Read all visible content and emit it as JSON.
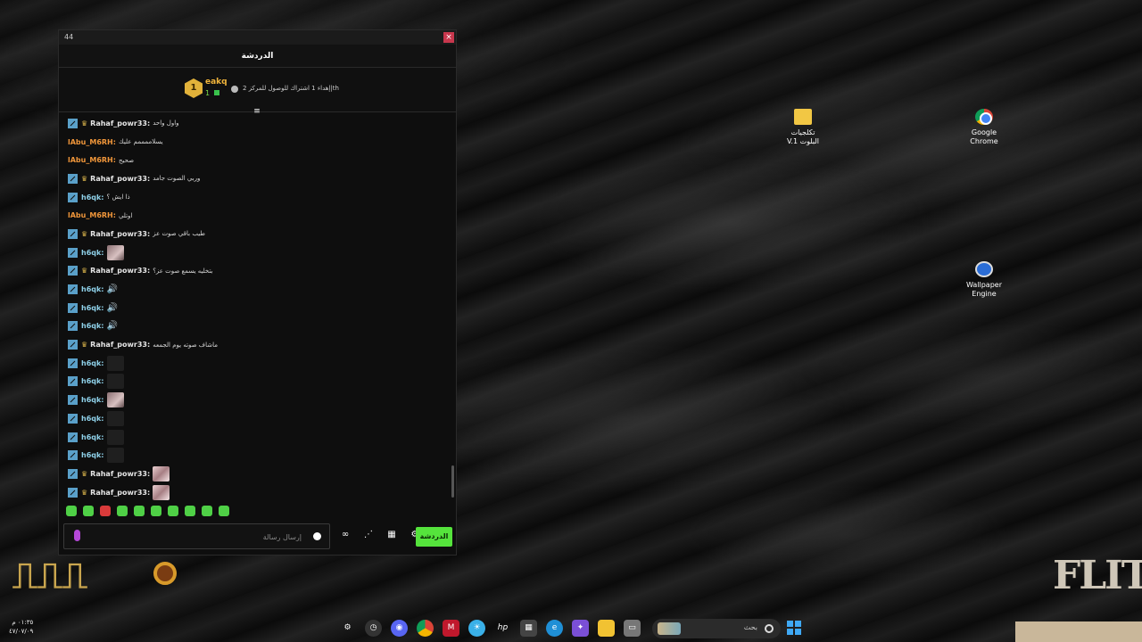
{
  "window": {
    "title": "44",
    "close_label": "×"
  },
  "chat": {
    "header_title": "الدردشة",
    "top_user": {
      "rank": "1",
      "username": "eakq",
      "count": "1",
      "info": "إهداء 1 اشتراك للوصول للمركز 2|th"
    },
    "collapse_icon": "≡",
    "messages": [
      {
        "user": "Rahaf_powr33:",
        "kind": "rahaf",
        "text": "واول واحد",
        "content": "text"
      },
      {
        "user": "lAbu_M6RH:",
        "kind": "abu",
        "text": "يسلاممممم عليك",
        "content": "text"
      },
      {
        "user": "lAbu_M6RH:",
        "kind": "abu",
        "text": "صحيح",
        "content": "text"
      },
      {
        "user": "Rahaf_powr33:",
        "kind": "rahaf",
        "text": "وربي الصوت جامد",
        "content": "text"
      },
      {
        "user": "h6qk:",
        "kind": "h6qk",
        "text": "ذا ايش ؟",
        "content": "text"
      },
      {
        "user": "lAbu_M6RH:",
        "kind": "abu",
        "text": "اوتلي",
        "content": "text"
      },
      {
        "user": "Rahaf_powr33:",
        "kind": "rahaf",
        "text": "طيب باقي صوت عز",
        "content": "text"
      },
      {
        "user": "h6qk:",
        "kind": "h6qk",
        "text": "",
        "content": "photo"
      },
      {
        "user": "Rahaf_powr33:",
        "kind": "rahaf",
        "text": "بتخليه يسمع صوت عز؟",
        "content": "text"
      },
      {
        "user": "h6qk:",
        "kind": "h6qk",
        "text": "",
        "content": "audio"
      },
      {
        "user": "h6qk:",
        "kind": "h6qk",
        "text": "",
        "content": "audio"
      },
      {
        "user": "h6qk:",
        "kind": "h6qk",
        "text": "",
        "content": "audio"
      },
      {
        "user": "Rahaf_powr33:",
        "kind": "rahaf",
        "text": "ماشاف صوته يوم الجمعه",
        "content": "text"
      },
      {
        "user": "h6qk:",
        "kind": "h6qk",
        "text": "",
        "content": "dark"
      },
      {
        "user": "h6qk:",
        "kind": "h6qk",
        "text": "",
        "content": "dark"
      },
      {
        "user": "h6qk:",
        "kind": "h6qk",
        "text": "",
        "content": "photo"
      },
      {
        "user": "h6qk:",
        "kind": "h6qk",
        "text": "",
        "content": "dark"
      },
      {
        "user": "h6qk:",
        "kind": "h6qk",
        "text": "",
        "content": "dark"
      },
      {
        "user": "h6qk:",
        "kind": "h6qk",
        "text": "",
        "content": "dark"
      },
      {
        "user": "Rahaf_powr33:",
        "kind": "rahaf",
        "text": "",
        "content": "photo2"
      },
      {
        "user": "Rahaf_powr33:",
        "kind": "rahaf",
        "text": "",
        "content": "photo2"
      }
    ],
    "emotes": [
      "emote-1",
      "emote-2",
      "emote-3",
      "emote-4",
      "emote-5",
      "emote-6",
      "emote-7",
      "emote-8",
      "emote-9",
      "emote-10"
    ],
    "composer": {
      "placeholder": "إرسال رسالة"
    },
    "send_label": "الدردشة",
    "colors": {
      "send": "#55e33c",
      "abu": "#f0963a",
      "h6qk": "#8ed0e8",
      "accent_close": "#c8374d"
    }
  },
  "desktop": {
    "icons": [
      {
        "label_line1": "تكلجيات",
        "label_line2": "V.1 البلوت",
        "icon": "folder-icon"
      },
      {
        "label_line1": "Google",
        "label_line2": "Chrome",
        "icon": "chrome-icon"
      },
      {
        "label_line1": "Wallpaper",
        "label_line2": "Engine",
        "icon": "wallpaper-engine-icon"
      }
    ],
    "logo_right": "FLITE"
  },
  "taskbar": {
    "time": "٠١:٣٥ م",
    "date": "٤٧/٠٧/٠٩",
    "search_text": "بحث"
  }
}
